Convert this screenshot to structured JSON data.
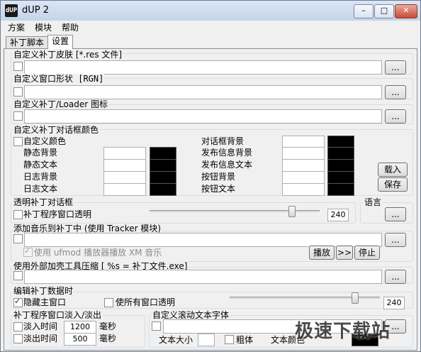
{
  "window": {
    "title": "dUP 2",
    "icon_text": "dUP"
  },
  "titlebar": {
    "minimize": "–",
    "maximize": "□",
    "close": "✕"
  },
  "menu": [
    "方案",
    "模块",
    "帮助"
  ],
  "tabs": [
    "补丁脚本",
    "设置"
  ],
  "skin": {
    "title": "自定义补丁皮肤 [*.res 文件]",
    "browse": "..."
  },
  "shape": {
    "title": "自定义窗口形状 [RGN]",
    "browse": "..."
  },
  "icon": {
    "title": "自定义补丁/Loader 图标",
    "browse": "..."
  },
  "colors": {
    "title": "自定义补丁对话框颜色",
    "custom_label": "自定义颜色",
    "left": [
      "静态背景",
      "静态文本",
      "日志背景",
      "日志文本"
    ],
    "right": [
      "对话框背景",
      "发布信息背景",
      "发布信息文本",
      "按钮背景",
      "按钮文本"
    ],
    "load_btn": "载入",
    "save_btn": "保存"
  },
  "transparent": {
    "title": "透明补丁对话框",
    "checkbox": "补丁程序窗口透明",
    "value": "240",
    "slider_level": 0.85
  },
  "language": {
    "title": "语言",
    "browse": "..."
  },
  "music": {
    "title": "添加音乐到补丁中 (使用 Tracker 模块)",
    "ufmod": "使用 ufmod 播放器播放 XM 音乐",
    "play": "播放",
    "next": ">>",
    "stop": "停止",
    "browse": "..."
  },
  "packer": {
    "title": "使用外部加壳工具压缩 [ %s = 补丁文件.exe]",
    "browse": "..."
  },
  "edit": {
    "title": "编辑补丁数据时",
    "hide_main": "隐藏主窗口",
    "all_transparent": "使所有窗口透明",
    "value": "240",
    "slider_level": 0.85
  },
  "fade": {
    "title": "补丁程序窗口淡入/淡出",
    "fade_in_label": "淡入时间",
    "fade_in_value": "1200",
    "fade_out_label": "淡出时间",
    "fade_out_value": "500",
    "unit": "毫秒"
  },
  "scroller": {
    "title": "自定义滚动文本字体",
    "size_label": "文本大小",
    "bold_label": "粗体",
    "color_label": "文本颜色",
    "browse": "..."
  },
  "watermark": "极速下载站"
}
